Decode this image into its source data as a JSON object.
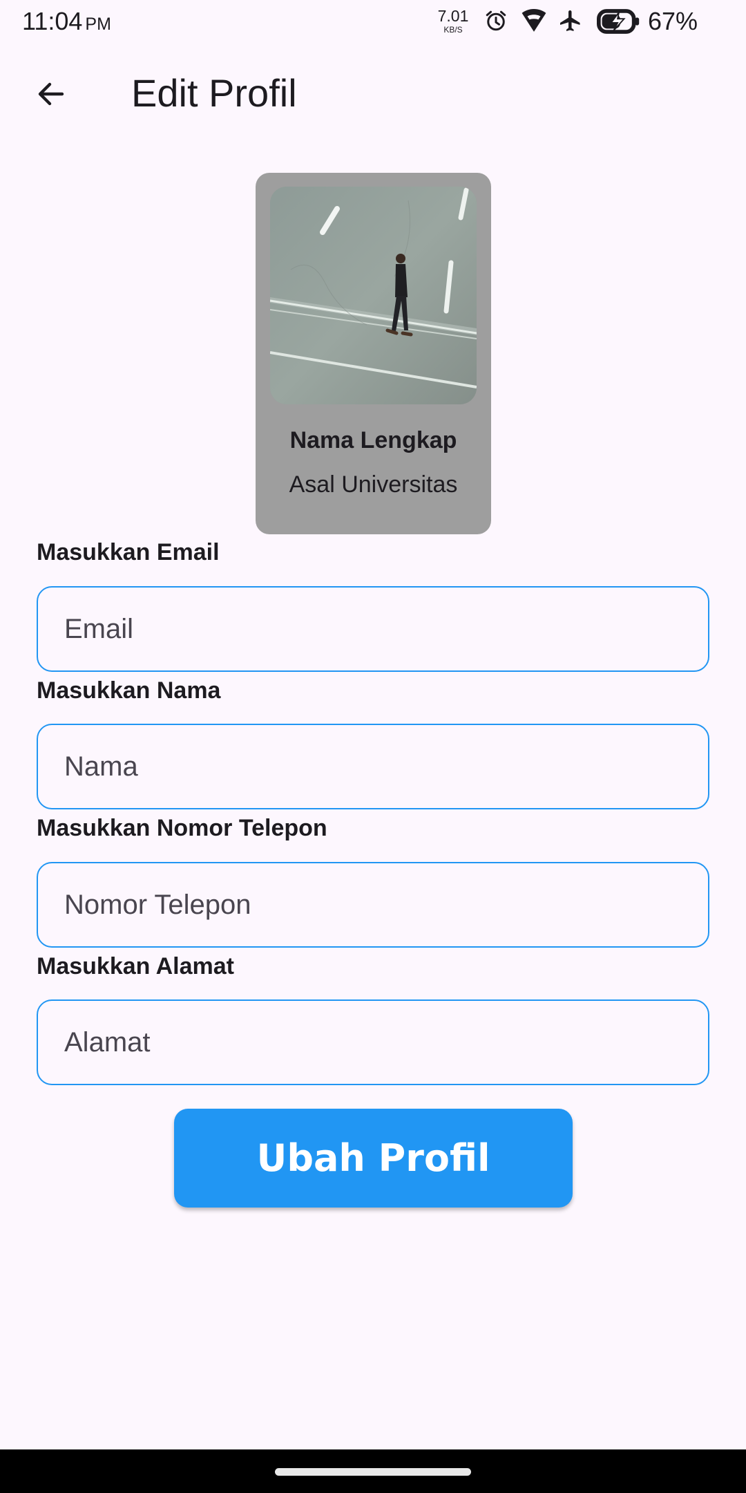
{
  "status_bar": {
    "time": "11:04",
    "ampm": "PM",
    "net_speed_value": "7.01",
    "net_speed_unit": "KB/S",
    "battery_percent": "67%",
    "icons": [
      "alarm-icon",
      "wifi-icon",
      "airplane-icon",
      "battery-charging-icon"
    ]
  },
  "app_bar": {
    "back_icon": "arrow-back-icon",
    "title": "Edit Profil"
  },
  "profile_card": {
    "name": "Nama Lengkap",
    "university": "Asal Universitas",
    "photo": "person-walking-on-road-photo"
  },
  "form": {
    "email_label": "Masukkan Email",
    "email_placeholder": "Email",
    "name_label": "Masukkan Nama",
    "name_placeholder": "Nama",
    "phone_label": "Masukkan Nomor Telepon",
    "phone_placeholder": "Nomor Telepon",
    "address_label": "Masukkan Alamat",
    "address_placeholder": "Alamat",
    "submit_label": "Ubah Profil"
  },
  "colors": {
    "accent": "#2196f3",
    "background": "#fdf7fe",
    "card": "#9e9e9e"
  }
}
